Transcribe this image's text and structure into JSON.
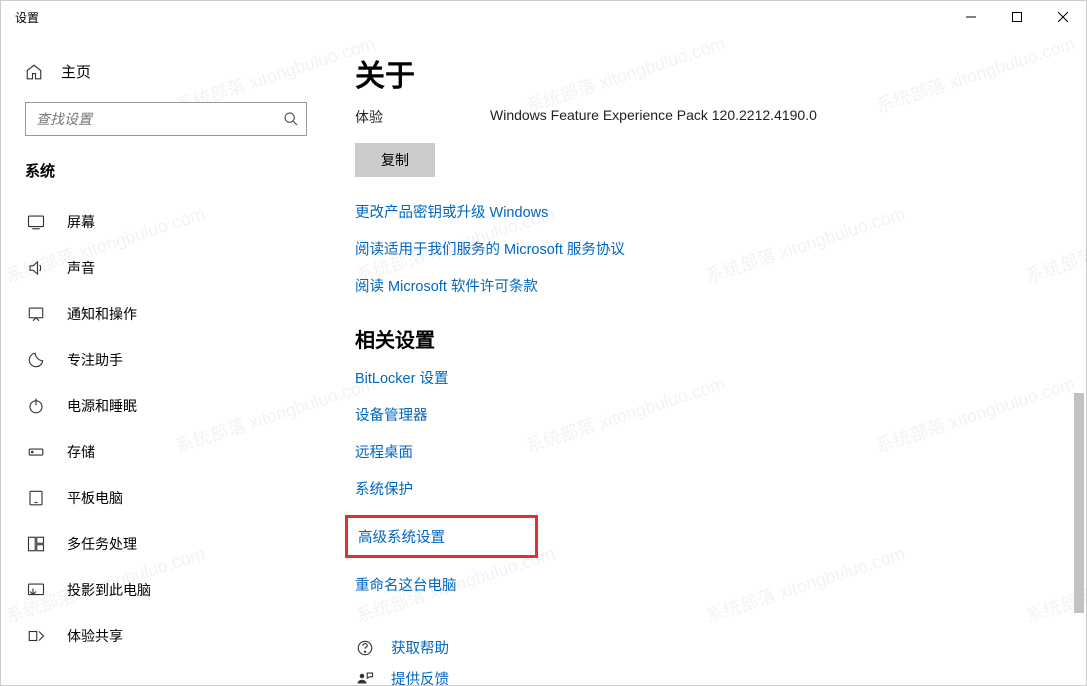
{
  "titlebar": {
    "title": "设置"
  },
  "sidebar": {
    "home": "主页",
    "search_placeholder": "查找设置",
    "category": "系统",
    "items": [
      {
        "label": "屏幕"
      },
      {
        "label": "声音"
      },
      {
        "label": "通知和操作"
      },
      {
        "label": "专注助手"
      },
      {
        "label": "电源和睡眠"
      },
      {
        "label": "存储"
      },
      {
        "label": "平板电脑"
      },
      {
        "label": "多任务处理"
      },
      {
        "label": "投影到此电脑"
      },
      {
        "label": "体验共享"
      }
    ]
  },
  "content": {
    "heading": "关于",
    "experience_label": "体验",
    "experience_value": "Windows Feature Experience Pack 120.2212.4190.0",
    "copy_button": "复制",
    "links_top": [
      "更改产品密钥或升级 Windows",
      "阅读适用于我们服务的 Microsoft 服务协议",
      "阅读 Microsoft 软件许可条款"
    ],
    "related_heading": "相关设置",
    "related_links": [
      "BitLocker 设置",
      "设备管理器",
      "远程桌面",
      "系统保护",
      "高级系统设置",
      "重命名这台电脑"
    ],
    "highlighted_index": 4,
    "help_links": [
      "获取帮助",
      "提供反馈"
    ]
  },
  "watermark_text": "系统部落 xitongbuluo.com"
}
